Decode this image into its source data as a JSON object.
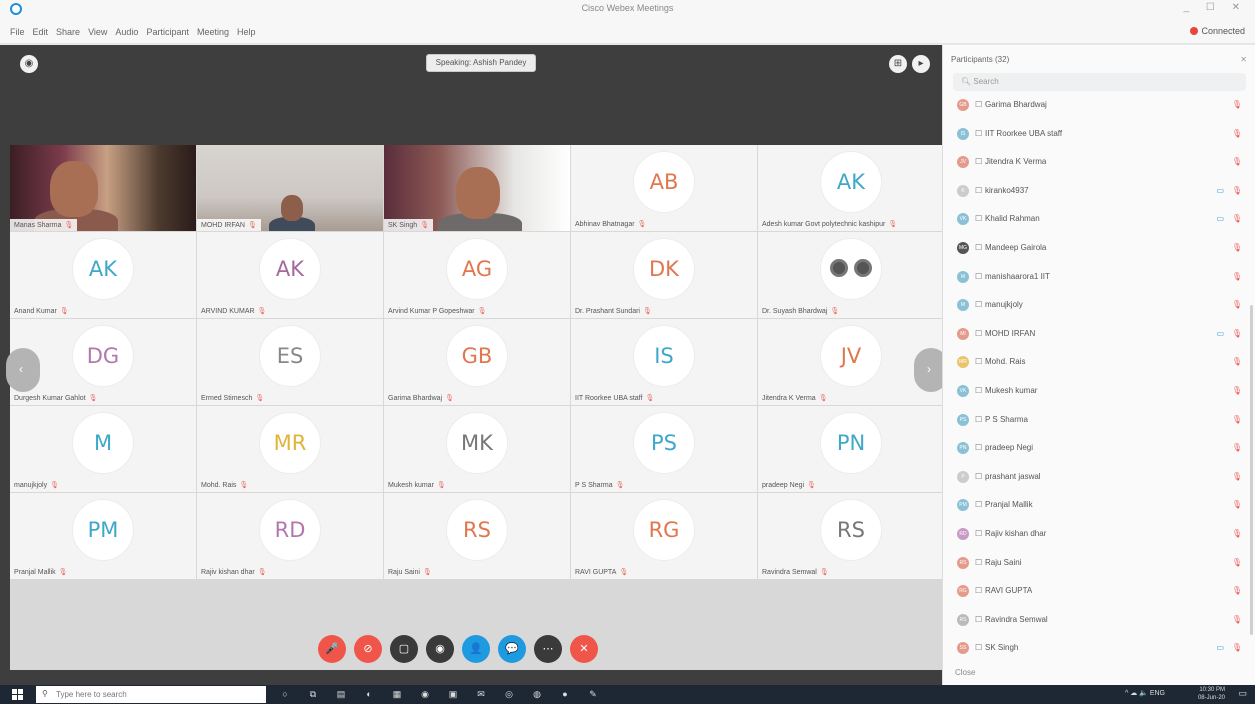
{
  "window": {
    "title": "Cisco Webex Meetings",
    "controls": "_ ☐ ✕"
  },
  "menu": {
    "items": [
      "File",
      "Edit",
      "Share",
      "View",
      "Audio",
      "Participant",
      "Meeting",
      "Help"
    ],
    "connected": "Connected"
  },
  "stage": {
    "speaking": "Speaking: Ashish Pandey"
  },
  "tiles": [
    {
      "kind": "video",
      "variant": "video1",
      "name": "Manas Sharma"
    },
    {
      "kind": "video",
      "variant": "video2",
      "name": "MOHD IRFAN"
    },
    {
      "kind": "video",
      "variant": "video3",
      "name": "SK Singh"
    },
    {
      "kind": "avatar",
      "initials": "AB",
      "color": "#e0774f",
      "name": "Abhinav Bhatnagar"
    },
    {
      "kind": "avatar",
      "initials": "AK",
      "color": "#3fa8c9",
      "name": "Adesh kumar Govt polytechnic kashipur"
    },
    {
      "kind": "avatar",
      "initials": "AK",
      "color": "#3fa8c9",
      "name": "Anand Kumar"
    },
    {
      "kind": "avatar",
      "initials": "AK",
      "color": "#a5689d",
      "name": "ARVIND KUMAR"
    },
    {
      "kind": "avatar",
      "initials": "AG",
      "color": "#e0774f",
      "name": "Arvind Kumar P Gopeshwar"
    },
    {
      "kind": "avatar",
      "initials": "DK",
      "color": "#e0774f",
      "name": "Dr. Prashant Sundari"
    },
    {
      "kind": "eyes",
      "name": "Dr. Suyash Bhardwaj"
    },
    {
      "kind": "avatar",
      "initials": "DG",
      "color": "#b278ae",
      "name": "Durgesh Kumar Gahlot"
    },
    {
      "kind": "avatar",
      "initials": "ES",
      "color": "#888888",
      "name": "Ermed Stimesch"
    },
    {
      "kind": "avatar",
      "initials": "GB",
      "color": "#e0774f",
      "name": "Garima Bhardwaj"
    },
    {
      "kind": "avatar",
      "initials": "IS",
      "color": "#3fa8c9",
      "name": "IIT Roorkee UBA staff"
    },
    {
      "kind": "avatar",
      "initials": "JV",
      "color": "#e0774f",
      "name": "Jitendra K Verma"
    },
    {
      "kind": "avatar",
      "initials": "M",
      "color": "#3fa8c9",
      "name": "manujkjoly"
    },
    {
      "kind": "avatar",
      "initials": "MR",
      "color": "#e2b339",
      "name": "Mohd. Rais"
    },
    {
      "kind": "avatar",
      "initials": "MK",
      "color": "#777777",
      "name": "Mukesh kumar"
    },
    {
      "kind": "avatar",
      "initials": "PS",
      "color": "#3fa8c9",
      "name": "P S Sharma"
    },
    {
      "kind": "avatar",
      "initials": "PN",
      "color": "#3fa8c9",
      "name": "pradeep Negi"
    },
    {
      "kind": "avatar",
      "initials": "PM",
      "color": "#3fa8c9",
      "name": "Pranjal Mallik"
    },
    {
      "kind": "avatar",
      "initials": "RD",
      "color": "#b278ae",
      "name": "Rajiv kishan dhar"
    },
    {
      "kind": "avatar",
      "initials": "RS",
      "color": "#e0774f",
      "name": "Raju Saini"
    },
    {
      "kind": "avatar",
      "initials": "RG",
      "color": "#e0774f",
      "name": "RAVI GUPTA"
    },
    {
      "kind": "avatar",
      "initials": "RS",
      "color": "#777777",
      "name": "Ravindra Semwal"
    }
  ],
  "controls": [
    {
      "name": "mute-button",
      "color": "#f0554a",
      "glyph": "🎤"
    },
    {
      "name": "stop-video-button",
      "color": "#f0554a",
      "glyph": "⊘"
    },
    {
      "name": "share-button",
      "color": "#3a3a3a",
      "glyph": "▢"
    },
    {
      "name": "record-button",
      "color": "#3a3a3a",
      "glyph": "◉"
    },
    {
      "name": "participants-button",
      "color": "#1e9be0",
      "glyph": "👤"
    },
    {
      "name": "chat-button",
      "color": "#1e9be0",
      "glyph": "💬"
    },
    {
      "name": "more-button",
      "color": "#3a3a3a",
      "glyph": "⋯"
    },
    {
      "name": "leave-button",
      "color": "#f0554a",
      "glyph": "✕"
    }
  ],
  "panel": {
    "title": "Participants (32)",
    "search_placeholder": "Search",
    "footer": "Close",
    "participants": [
      {
        "initials": "GB",
        "color": "#e59b8b",
        "name": "Garima Bhardwaj",
        "cam": ""
      },
      {
        "initials": "IS",
        "color": "#8bc1d6",
        "name": "IIT Roorkee UBA staff",
        "cam": ""
      },
      {
        "initials": "JV",
        "color": "#e59b8b",
        "name": "Jitendra K Verma",
        "cam": ""
      },
      {
        "initials": "K",
        "color": "#cccccc",
        "name": "kiranko4937",
        "cam": "▭"
      },
      {
        "initials": "VK",
        "color": "#8bc1d6",
        "name": "Khalid Rahman",
        "cam": "▭"
      },
      {
        "initials": "MG",
        "color": "#555555",
        "name": "Mandeep Gairola",
        "cam": ""
      },
      {
        "initials": "M",
        "color": "#8bc1d6",
        "name": "manishaarora1 IIT",
        "cam": ""
      },
      {
        "initials": "M",
        "color": "#8bc1d6",
        "name": "manujkjoly",
        "cam": ""
      },
      {
        "initials": "MI",
        "color": "#e59b8b",
        "name": "MOHD IRFAN",
        "cam": "▭"
      },
      {
        "initials": "MR",
        "color": "#e8c56b",
        "name": "Mohd. Rais",
        "cam": ""
      },
      {
        "initials": "VK",
        "color": "#8bc1d6",
        "name": "Mukesh kumar",
        "cam": ""
      },
      {
        "initials": "PS",
        "color": "#8bc1d6",
        "name": "P S Sharma",
        "cam": ""
      },
      {
        "initials": "PN",
        "color": "#8bc1d6",
        "name": "pradeep Negi",
        "cam": ""
      },
      {
        "initials": "P",
        "color": "#cccccc",
        "name": "prashant jaswal",
        "cam": ""
      },
      {
        "initials": "PM",
        "color": "#8bc1d6",
        "name": "Pranjal Mallik",
        "cam": ""
      },
      {
        "initials": "RD",
        "color": "#c89ac4",
        "name": "Rajiv kishan dhar",
        "cam": ""
      },
      {
        "initials": "RS",
        "color": "#e59b8b",
        "name": "Raju Saini",
        "cam": ""
      },
      {
        "initials": "RG",
        "color": "#e59b8b",
        "name": "RAVI GUPTA",
        "cam": ""
      },
      {
        "initials": "RS",
        "color": "#bbbbbb",
        "name": "Ravindra Semwal",
        "cam": ""
      },
      {
        "initials": "SS",
        "color": "#e59b8b",
        "name": "SK Singh",
        "cam": "▭"
      }
    ]
  },
  "taskbar": {
    "search_placeholder": "Type here to search",
    "tray": "^ ☁ 🔈 ENG",
    "time": "10:30 PM",
    "date": "08-Jun-20"
  }
}
